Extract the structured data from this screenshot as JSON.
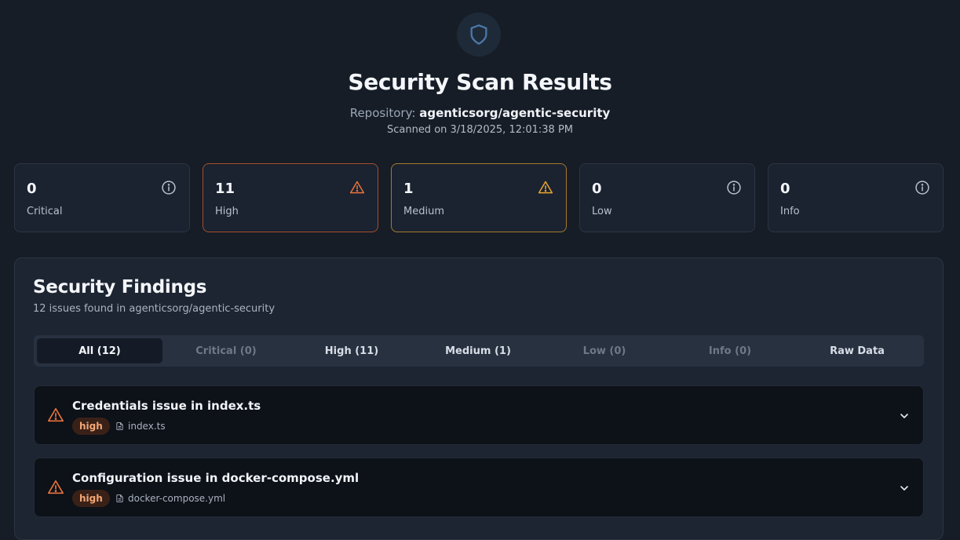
{
  "header": {
    "icon": "shield-icon",
    "title": "Security Scan Results",
    "repo_prefix": "Repository:",
    "repo_name": "agenticsorg/agentic-security",
    "scanned_on": "Scanned on 3/18/2025, 12:01:38 PM"
  },
  "stats": [
    {
      "count": "0",
      "label": "Critical",
      "icon": "info-circle-icon"
    },
    {
      "count": "11",
      "label": "High",
      "icon": "warning-triangle-icon",
      "color": "#e8743b"
    },
    {
      "count": "1",
      "label": "Medium",
      "icon": "warning-triangle-icon",
      "color": "#e9a530"
    },
    {
      "count": "0",
      "label": "Low",
      "icon": "info-circle-icon"
    },
    {
      "count": "0",
      "label": "Info",
      "icon": "info-circle-icon"
    }
  ],
  "findings_panel": {
    "title": "Security Findings",
    "subtitle": "12 issues found in agenticsorg/agentic-security",
    "tabs": [
      {
        "label": "All (12)",
        "active": true
      },
      {
        "label": "Critical (0)"
      },
      {
        "label": "High (11)"
      },
      {
        "label": "Medium (1)"
      },
      {
        "label": "Low (0)"
      },
      {
        "label": "Info (0)"
      },
      {
        "label": "Raw Data"
      }
    ],
    "findings": [
      {
        "title": "Credentials issue in index.ts",
        "severity": "high",
        "file": "index.ts"
      },
      {
        "title": "Configuration issue in docker-compose.yml",
        "severity": "high",
        "file": "docker-compose.yml"
      }
    ]
  },
  "colors": {
    "background": "#161d27",
    "high": "#e8743b",
    "medium": "#e9a530",
    "shield": "#4a78a8"
  }
}
